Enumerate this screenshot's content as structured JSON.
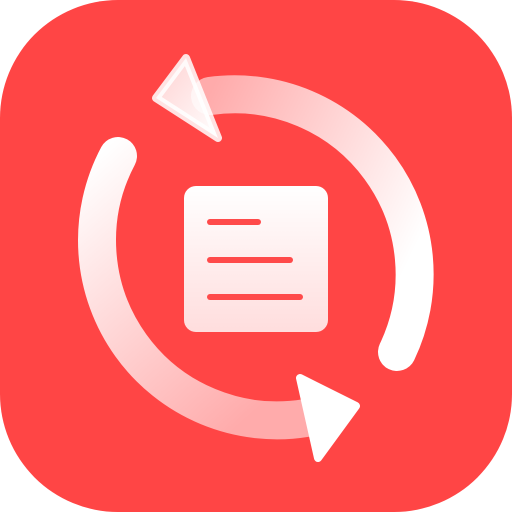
{
  "icon": {
    "name": "sync-document-app-icon",
    "background_color": "#FF4545",
    "glyph_color": "#FFFFFF",
    "line_color": "#FF4A4A"
  }
}
